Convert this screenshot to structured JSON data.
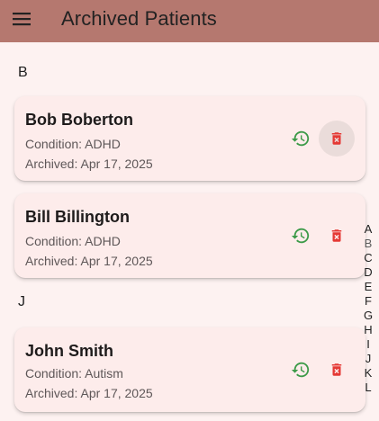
{
  "app_bar": {
    "title": "Archived Patients",
    "icon": "menu-icon",
    "background": "#b5786f"
  },
  "sections": [
    {
      "letter": "B",
      "patients": [
        {
          "name": "Bob Boberton",
          "condition": "Condition: ADHD",
          "archived": "Archived: Apr 17, 2025"
        },
        {
          "name": "Bill Billington",
          "condition": "Condition: ADHD",
          "archived": "Archived: Apr 17, 2025"
        }
      ]
    },
    {
      "letter": "J",
      "patients": [
        {
          "name": "John Smith",
          "condition": "Condition: Autism",
          "archived": "Archived: Apr 17, 2025"
        }
      ]
    }
  ],
  "actions": {
    "restore_icon": "restore-icon",
    "delete_icon": "delete-icon",
    "restore_color": "#3c9a48",
    "delete_color": "#e53935"
  },
  "alpha_index": [
    "A",
    "B",
    "C",
    "D",
    "E",
    "F",
    "G",
    "H",
    "I",
    "J",
    "K",
    "L"
  ]
}
